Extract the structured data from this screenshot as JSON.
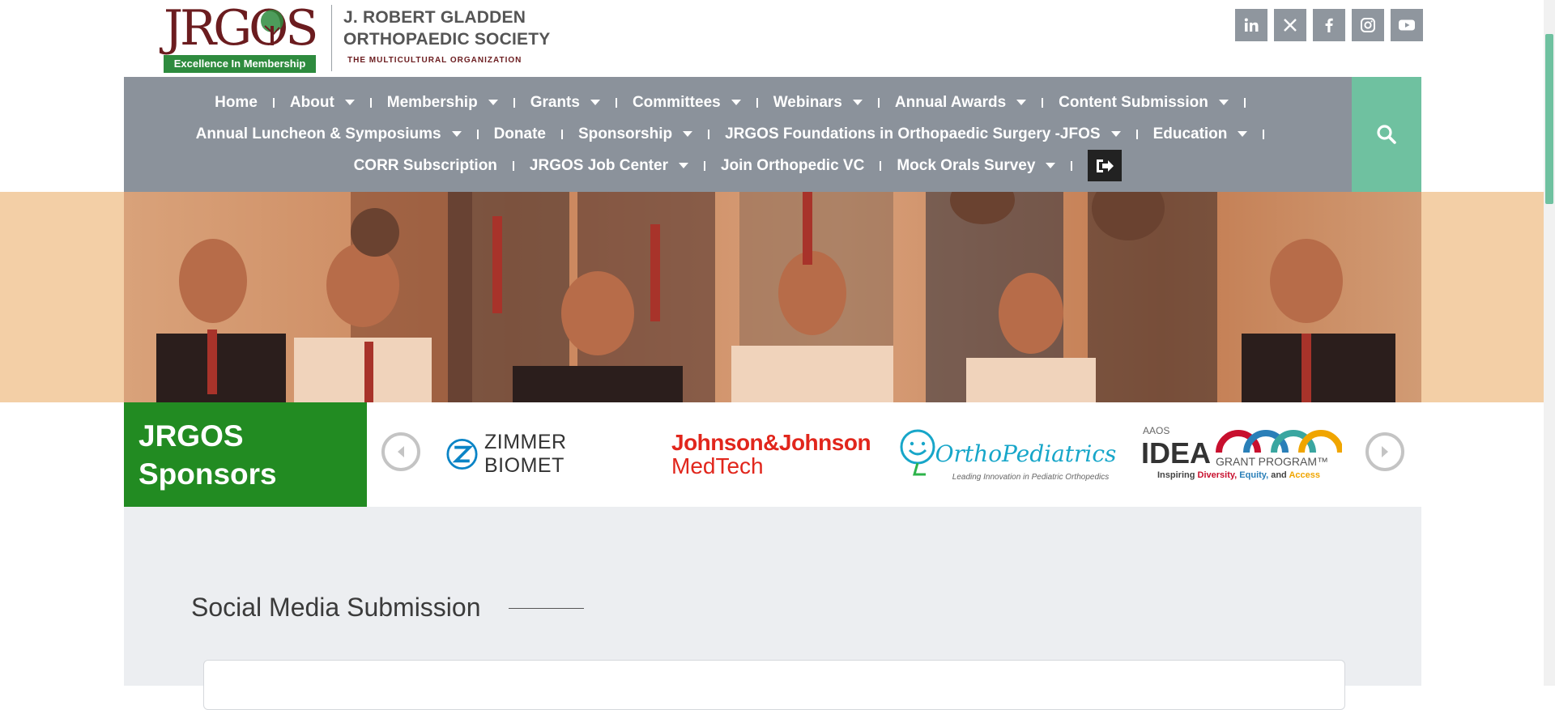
{
  "header": {
    "logo_text": "JRGOS",
    "logo_tagline": "Excellence In Membership",
    "org_name_line1": "J. ROBERT GLADDEN",
    "org_name_line2": "ORTHOPAEDIC SOCIETY",
    "org_subtitle": "THE MULTICULTURAL ORGANIZATION",
    "social_links": [
      "linkedin-icon",
      "x-icon",
      "facebook-icon",
      "instagram-icon",
      "youtube-icon"
    ]
  },
  "nav": {
    "row1": [
      {
        "label": "Home",
        "dropdown": false
      },
      {
        "label": "About",
        "dropdown": true
      },
      {
        "label": "Membership",
        "dropdown": true
      },
      {
        "label": "Grants",
        "dropdown": true
      },
      {
        "label": "Committees",
        "dropdown": true
      },
      {
        "label": "Webinars",
        "dropdown": true
      },
      {
        "label": "Annual Awards",
        "dropdown": true
      },
      {
        "label": "Content Submission",
        "dropdown": true
      }
    ],
    "row2": [
      {
        "label": "Annual Luncheon & Symposiums",
        "dropdown": true
      },
      {
        "label": "Donate",
        "dropdown": false
      },
      {
        "label": "Sponsorship",
        "dropdown": true
      },
      {
        "label": "JRGOS Foundations in Orthopaedic Surgery -JFOS",
        "dropdown": true
      },
      {
        "label": "Education",
        "dropdown": true
      }
    ],
    "row3": [
      {
        "label": "CORR Subscription",
        "dropdown": false
      },
      {
        "label": "JRGOS Job Center",
        "dropdown": true
      },
      {
        "label": "Join Orthopedic VC",
        "dropdown": false
      },
      {
        "label": "Mock Orals Survey",
        "dropdown": true
      }
    ]
  },
  "sponsors": {
    "title_line1": "JRGOS",
    "title_line2": "Sponsors",
    "logos": {
      "zimmer": "ZIMMER BIOMET",
      "jnj_line1": "Johnson&Johnson",
      "jnj_line2": "MedTech",
      "ortho": "OrthoPediatrics",
      "ortho_sub": "Leading Innovation in Pediatric Orthopedics",
      "aaos_top": "AAOS",
      "aaos_idea": "IDEA",
      "aaos_grant": "GRANT PROGRAM™",
      "aaos_inspiring": "Inspiring",
      "aaos_diversity": "Diversity,",
      "aaos_equity": "Equity,",
      "aaos_and": "and",
      "aaos_access": "Access"
    }
  },
  "content": {
    "section_title": "Social Media Submission"
  },
  "colors": {
    "nav_bg": "#8b929b",
    "search_bg": "#6fc1a0",
    "sponsor_green": "#228b22",
    "brand_maroon": "#6b1c1f"
  }
}
